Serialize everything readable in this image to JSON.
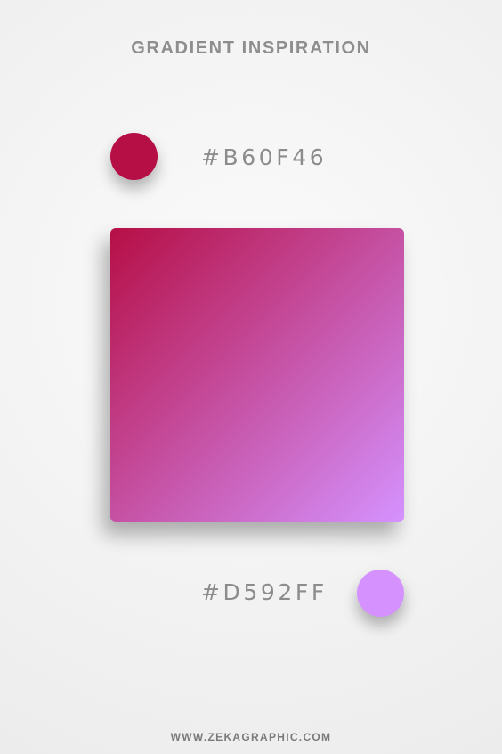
{
  "title": "GRADIENT INSPIRATION",
  "colors": {
    "start": "#B60F46",
    "end": "#D592FF"
  },
  "labels": {
    "start_hex": "#B60F46",
    "end_hex": "#D592FF"
  },
  "footer": "WWW.ZEKAGRAPHIC.COM"
}
